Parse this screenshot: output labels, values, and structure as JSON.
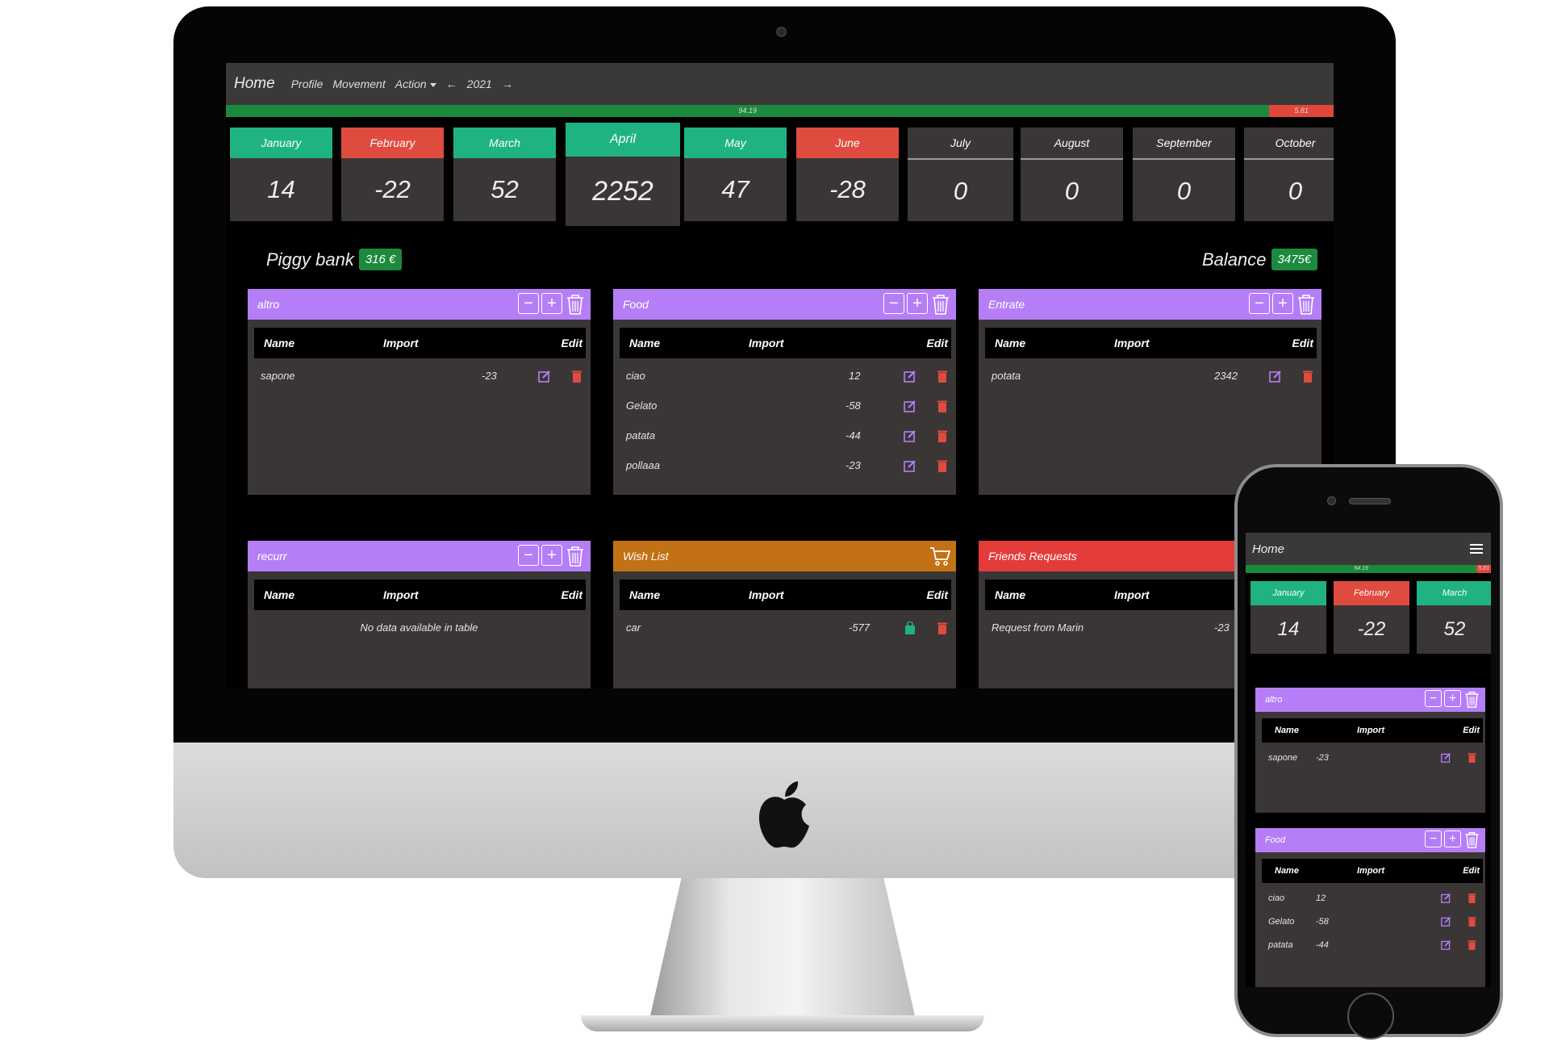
{
  "nav": {
    "brand": "Home",
    "links": [
      "Profile",
      "Movement",
      "Action"
    ],
    "prev_arrow": "←",
    "year": "2021",
    "next_arrow": "→"
  },
  "progress": {
    "green_pct": 94.19,
    "green_label": "94.19",
    "red_pct": 5.81,
    "red_label": "5.81"
  },
  "months": [
    {
      "name": "January",
      "value": "14",
      "color": "green"
    },
    {
      "name": "February",
      "value": "-22",
      "color": "red"
    },
    {
      "name": "March",
      "value": "52",
      "color": "green"
    },
    {
      "name": "April",
      "value": "2252",
      "color": "green"
    },
    {
      "name": "May",
      "value": "47",
      "color": "green"
    },
    {
      "name": "June",
      "value": "-28",
      "color": "red"
    },
    {
      "name": "July",
      "value": "0",
      "color": "none"
    },
    {
      "name": "August",
      "value": "0",
      "color": "none"
    },
    {
      "name": "September",
      "value": "0",
      "color": "none"
    },
    {
      "name": "October",
      "value": "0",
      "color": "none"
    }
  ],
  "piggy": {
    "label": "Piggy bank",
    "value": "316 €"
  },
  "balance": {
    "label": "Balance",
    "value": "3475€"
  },
  "table_headers": {
    "name": "Name",
    "import": "Import",
    "edit": "Edit"
  },
  "panels": [
    {
      "title": "altro",
      "rows": [
        {
          "name": "sapone",
          "import": "-23"
        }
      ]
    },
    {
      "title": "Food",
      "rows": [
        {
          "name": "ciao",
          "import": "12"
        },
        {
          "name": "Gelato",
          "import": "-58"
        },
        {
          "name": "patata",
          "import": "-44"
        },
        {
          "name": "pollaaa",
          "import": "-23"
        }
      ]
    },
    {
      "title": "Entrate",
      "rows": [
        {
          "name": "potata",
          "import": "2342"
        }
      ]
    },
    {
      "title": "recurr",
      "empty": "No data available in table"
    },
    {
      "title": "Wish List",
      "rows": [
        {
          "name": "car",
          "import": "-577"
        }
      ]
    },
    {
      "title": "Friends Requests",
      "rows": [
        {
          "name": "Request from Marin",
          "import": "-23"
        }
      ]
    }
  ],
  "colors": {
    "green": "#1fb384",
    "red": "#e04b3f",
    "purple": "#b57ef7",
    "orange": "#c27114",
    "friends_red": "#e43b3b",
    "progress_green": "#1b8a3c"
  },
  "phone": {
    "brand": "Home",
    "menu_icon": "hamburger-icon",
    "progress": {
      "green_label": "94.19",
      "red_label": "5.81"
    },
    "months": [
      {
        "name": "January",
        "value": "14"
      },
      {
        "name": "February",
        "value": "-22"
      },
      {
        "name": "March",
        "value": "52"
      }
    ],
    "panels": [
      {
        "title": "altro",
        "rows": [
          {
            "name": "sapone",
            "import": "-23"
          }
        ]
      },
      {
        "title": "Food",
        "rows": [
          {
            "name": "ciao",
            "import": "12"
          },
          {
            "name": "Gelato",
            "import": "-58"
          },
          {
            "name": "patata",
            "import": "-44"
          }
        ]
      }
    ]
  }
}
